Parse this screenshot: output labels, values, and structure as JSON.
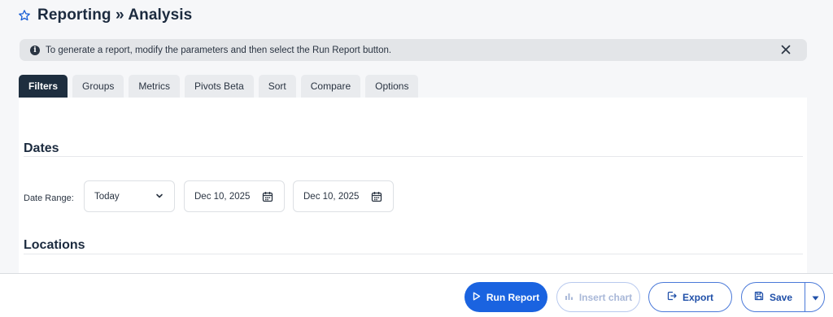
{
  "header": {
    "title": "Reporting » Analysis",
    "favorite_icon": "star-outline-icon"
  },
  "banner": {
    "message": "To generate a report, modify the parameters and then select the Run Report button.",
    "info_icon": "info-icon",
    "close_icon": "close-icon"
  },
  "tabs": [
    {
      "label": "Filters",
      "active": true
    },
    {
      "label": "Groups"
    },
    {
      "label": "Metrics"
    },
    {
      "label": "Pivots Beta"
    },
    {
      "label": "Sort"
    },
    {
      "label": "Compare"
    },
    {
      "label": "Options"
    }
  ],
  "sections": {
    "dates": {
      "title": "Dates",
      "date_range_label": "Date Range:",
      "range_select_value": "Today",
      "start_date": "Dec 10, 2025",
      "end_date": "Dec 10, 2025"
    },
    "locations": {
      "title": "Locations"
    }
  },
  "footer": {
    "run_report": "Run Report",
    "insert_chart": "Insert chart",
    "export": "Export",
    "save": "Save"
  },
  "colors": {
    "primary": "#1a63e0",
    "active_tab": "#1e2e3f",
    "banner_bg": "#e3e5e8"
  }
}
